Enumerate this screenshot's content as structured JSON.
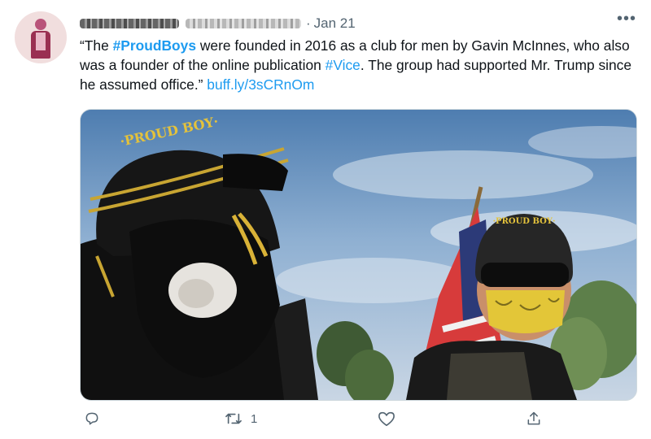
{
  "tweet": {
    "separator": "·",
    "date": "Jan 21",
    "more_icon": "more-horizontal-icon",
    "text_parts": {
      "t1": "“The ",
      "h1": "#ProudBoys",
      "t2": " were founded in 2016 as a club for men by Gavin McInnes, who also was a founder of the online publication ",
      "h2": "#Vice",
      "t3": ". The group had supported Mr. Trump since he assumed office.” ",
      "link": "buff.ly/3sCRnOm"
    },
    "photo": {
      "helmet_text_left": "·PROUD BOY·",
      "helmet_text_right": "·PROUD BOY·"
    },
    "actions": {
      "reply_icon": "reply-icon",
      "retweet_icon": "retweet-icon",
      "retweet_count": "1",
      "like_icon": "like-icon",
      "share_icon": "share-icon"
    }
  },
  "colors": {
    "link": "#1d9bf0",
    "text": "#0f1419",
    "muted": "#536471"
  }
}
